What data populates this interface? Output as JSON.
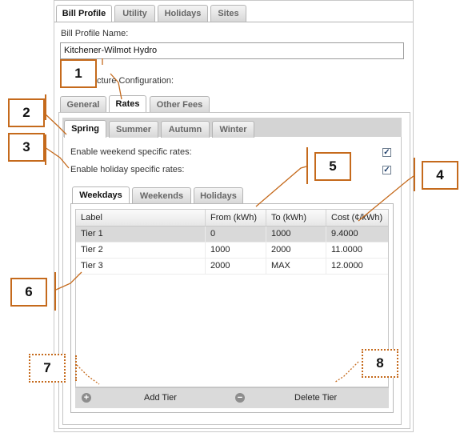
{
  "top_tabs": [
    "Bill Profile",
    "Utility",
    "Holidays",
    "Sites"
  ],
  "profile_name_label": "Bill Profile Name:",
  "profile_name_value": "Kitchener-Wilmot Hydro",
  "structure_label": "cture Configuration:",
  "config_tabs": [
    "General",
    "Rates",
    "Other Fees"
  ],
  "season_tabs": [
    "Spring",
    "Summer",
    "Autumn",
    "Winter"
  ],
  "options": [
    {
      "label": "Enable weekend specific rates:",
      "checked": true
    },
    {
      "label": "Enable holiday specific rates:",
      "checked": true
    }
  ],
  "day_tabs": [
    "Weekdays",
    "Weekends",
    "Holidays"
  ],
  "table": {
    "columns": [
      "Label",
      "From (kWh)",
      "To (kWh)",
      "Cost (¢/kWh)"
    ],
    "rows": [
      [
        "Tier 1",
        "0",
        "1000",
        "9.4000"
      ],
      [
        "Tier 2",
        "1000",
        "2000",
        "11.0000"
      ],
      [
        "Tier 3",
        "2000",
        "MAX",
        "12.0000"
      ]
    ]
  },
  "toolbar": {
    "add_label": "Add Tier",
    "delete_label": "Delete Tier",
    "add_icon": "plus-circle-icon",
    "delete_icon": "minus-circle-icon"
  },
  "callouts": [
    "1",
    "2",
    "3",
    "4",
    "5",
    "6",
    "7",
    "8"
  ],
  "colors": {
    "callout": "#c56a1c",
    "selected_row": "#d9d9d9"
  }
}
